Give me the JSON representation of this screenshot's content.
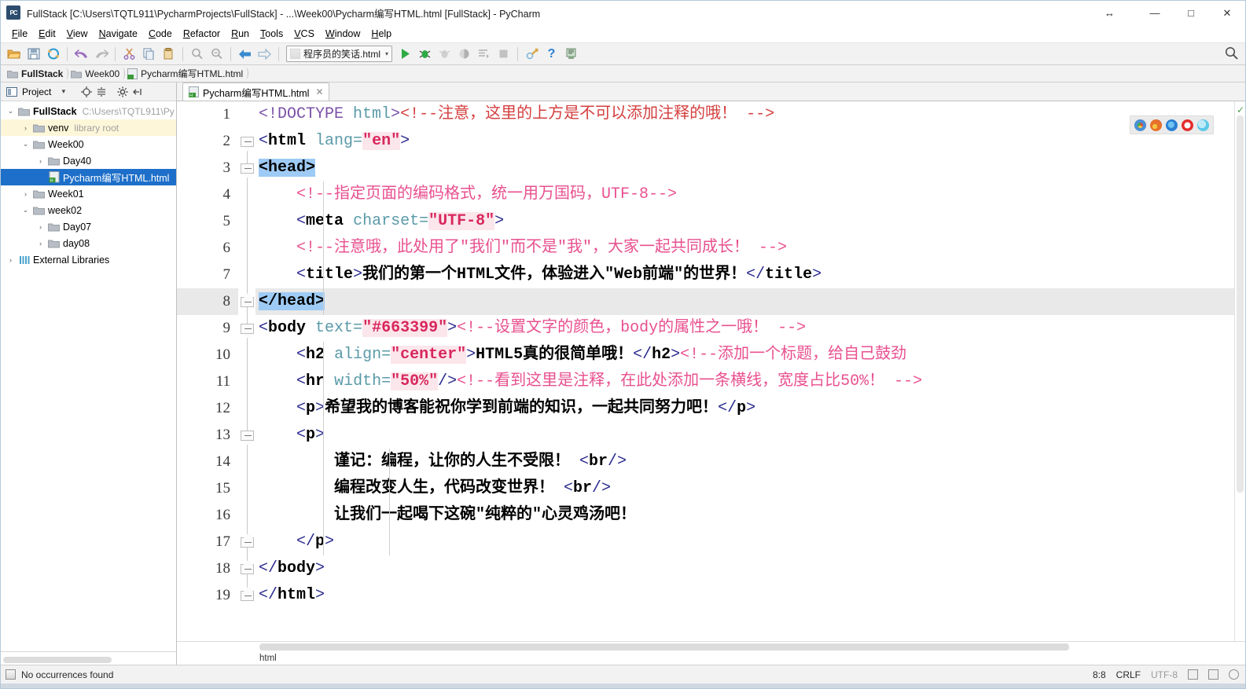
{
  "window": {
    "title": "FullStack [C:\\Users\\TQTL911\\PycharmProjects\\FullStack] - ...\\Week00\\Pycharm编写HTML.html [FullStack] - PyCharm",
    "app_icon_text": "PC",
    "resize_glyph": "↔",
    "minimize_glyph": "—",
    "maximize_glyph": "□",
    "close_glyph": "✕"
  },
  "menubar": {
    "items": [
      {
        "label": "File"
      },
      {
        "label": "Edit"
      },
      {
        "label": "View"
      },
      {
        "label": "Navigate"
      },
      {
        "label": "Code"
      },
      {
        "label": "Refactor"
      },
      {
        "label": "Run"
      },
      {
        "label": "Tools"
      },
      {
        "label": "VCS"
      },
      {
        "label": "Window"
      },
      {
        "label": "Help"
      }
    ]
  },
  "toolbar": {
    "run_config": {
      "label": "程序员的笑话.html",
      "arrow": "▾"
    },
    "search_glyph": "🔍",
    "help_glyph": "?",
    "icons": [
      "open-folder-icon",
      "save-all-icon",
      "sync-icon",
      "undo-icon",
      "redo-icon",
      "cut-icon",
      "copy-icon",
      "paste-icon",
      "find-icon",
      "replace-icon",
      "back-icon",
      "forward-icon",
      "run-icon",
      "debug-icon",
      "run-coverage-icon",
      "profile-icon",
      "run-with-console-icon",
      "stop-icon",
      "settings-icon",
      "help-icon",
      "update-icon"
    ]
  },
  "breadcrumb": {
    "items": [
      {
        "label": "FullStack",
        "icon": "folder-icon",
        "bold": true
      },
      {
        "label": "Week00",
        "icon": "folder-icon",
        "bold": false
      },
      {
        "label": "Pycharm编写HTML.html",
        "icon": "html-file-icon",
        "bold": false
      }
    ]
  },
  "project_panel": {
    "title": "Project",
    "dropdown_glyph": "▾",
    "toolbar_icons": [
      "locate-icon",
      "collapse-all-icon",
      "settings-icon",
      "hide-icon"
    ],
    "tree": [
      {
        "depth": 0,
        "arrow": "⌄",
        "icon": "folder-icon",
        "label": "FullStack",
        "bold": true,
        "sub": "C:\\Users\\TQTL911\\Py",
        "state": "normal"
      },
      {
        "depth": 1,
        "arrow": "›",
        "icon": "folder-icon",
        "label": "venv",
        "bold": false,
        "sub": "library root",
        "state": "highlight"
      },
      {
        "depth": 1,
        "arrow": "⌄",
        "icon": "folder-icon",
        "label": "Week00",
        "bold": false,
        "sub": "",
        "state": "normal"
      },
      {
        "depth": 2,
        "arrow": "›",
        "icon": "folder-icon",
        "label": "Day40",
        "bold": false,
        "sub": "",
        "state": "normal"
      },
      {
        "depth": 2,
        "arrow": "",
        "icon": "html-file-icon",
        "label": "Pycharm编写HTML.html",
        "bold": false,
        "sub": "",
        "state": "selected"
      },
      {
        "depth": 1,
        "arrow": "›",
        "icon": "folder-icon",
        "label": "Week01",
        "bold": false,
        "sub": "",
        "state": "normal"
      },
      {
        "depth": 1,
        "arrow": "⌄",
        "icon": "folder-icon",
        "label": "week02",
        "bold": false,
        "sub": "",
        "state": "normal"
      },
      {
        "depth": 2,
        "arrow": "›",
        "icon": "folder-icon",
        "label": "Day07",
        "bold": false,
        "sub": "",
        "state": "normal"
      },
      {
        "depth": 2,
        "arrow": "›",
        "icon": "folder-icon",
        "label": "day08",
        "bold": false,
        "sub": "",
        "state": "normal"
      },
      {
        "depth": 0,
        "arrow": "›",
        "icon": "external-libraries-icon",
        "label": "External Libraries",
        "bold": false,
        "sub": "",
        "state": "normal"
      }
    ]
  },
  "editor": {
    "tab": {
      "label": "Pycharm编写HTML.html",
      "icon": "html-file-icon",
      "close_glyph": "✕"
    },
    "current_line": 8,
    "line_count": 19,
    "browser_preview": {
      "icons": [
        "chrome-icon",
        "firefox-icon",
        "edge-icon",
        "opera-icon",
        "safari-icon"
      ],
      "colors": [
        "#d94a3d",
        "#e8712a",
        "#2a7fd4",
        "#e32b2b",
        "#5cc8e8"
      ]
    },
    "bottom_breadcrumb": "html",
    "lines": [
      {
        "n": 1,
        "fold": "none"
      },
      {
        "n": 2,
        "fold": "start"
      },
      {
        "n": 3,
        "fold": "start"
      },
      {
        "n": 4,
        "fold": "none"
      },
      {
        "n": 5,
        "fold": "none"
      },
      {
        "n": 6,
        "fold": "none"
      },
      {
        "n": 7,
        "fold": "none"
      },
      {
        "n": 8,
        "fold": "end"
      },
      {
        "n": 9,
        "fold": "start"
      },
      {
        "n": 10,
        "fold": "none"
      },
      {
        "n": 11,
        "fold": "none"
      },
      {
        "n": 12,
        "fold": "none"
      },
      {
        "n": 13,
        "fold": "start"
      },
      {
        "n": 14,
        "fold": "none"
      },
      {
        "n": 15,
        "fold": "none"
      },
      {
        "n": 16,
        "fold": "none"
      },
      {
        "n": 17,
        "fold": "end"
      },
      {
        "n": 18,
        "fold": "end"
      },
      {
        "n": 19,
        "fold": "end"
      }
    ],
    "code": [
      {
        "line": 1,
        "tokens": [
          {
            "t": "<!DOCTYPE ",
            "c": "s-doct"
          },
          {
            "t": "html",
            "c": "s-attr"
          },
          {
            "t": ">",
            "c": "s-doct"
          },
          {
            "t": "<!--注意，这里的上方是不可以添加注释的哦！ -->",
            "c": "s-cmtd"
          }
        ]
      },
      {
        "line": 2,
        "tokens": [
          {
            "t": "<",
            "c": "s-brk"
          },
          {
            "t": "html",
            "c": "s-tag"
          },
          {
            "t": " ",
            "c": "s-plain"
          },
          {
            "t": "lang=",
            "c": "s-attr"
          },
          {
            "t": "\"en\"",
            "c": "s-val"
          },
          {
            "t": ">",
            "c": "s-brk"
          }
        ]
      },
      {
        "line": 3,
        "tokens": [
          {
            "t": "<head>",
            "c": "s-tag s-sel"
          }
        ]
      },
      {
        "line": 4,
        "tokens": [
          {
            "t": "    ",
            "c": "s-plain"
          },
          {
            "t": "<!--指定页面的编码格式，统一用万国码，UTF-8-->",
            "c": "s-cmt"
          }
        ]
      },
      {
        "line": 5,
        "tokens": [
          {
            "t": "    ",
            "c": "s-plain"
          },
          {
            "t": "<",
            "c": "s-brk"
          },
          {
            "t": "meta",
            "c": "s-tag"
          },
          {
            "t": " ",
            "c": "s-plain"
          },
          {
            "t": "charset=",
            "c": "s-attr"
          },
          {
            "t": "\"UTF-8\"",
            "c": "s-val"
          },
          {
            "t": ">",
            "c": "s-brk"
          }
        ]
      },
      {
        "line": 6,
        "tokens": [
          {
            "t": "    ",
            "c": "s-plain"
          },
          {
            "t": "<!--注意哦，此处用了\"我们\"而不是\"我\"，大家一起共同成长！ -->",
            "c": "s-cmt"
          }
        ]
      },
      {
        "line": 7,
        "tokens": [
          {
            "t": "    ",
            "c": "s-plain"
          },
          {
            "t": "<",
            "c": "s-brk"
          },
          {
            "t": "title",
            "c": "s-tag"
          },
          {
            "t": ">",
            "c": "s-brk"
          },
          {
            "t": "我们的第一个HTML文件，体验进入\"Web前端\"的世界！",
            "c": "s-txt"
          },
          {
            "t": "</",
            "c": "s-brk"
          },
          {
            "t": "title",
            "c": "s-tag"
          },
          {
            "t": ">",
            "c": "s-brk"
          }
        ]
      },
      {
        "line": 8,
        "tokens": [
          {
            "t": "</head>",
            "c": "s-tag s-sel"
          }
        ]
      },
      {
        "line": 9,
        "tokens": [
          {
            "t": "<",
            "c": "s-brk"
          },
          {
            "t": "body",
            "c": "s-tag"
          },
          {
            "t": " ",
            "c": "s-plain"
          },
          {
            "t": "text=",
            "c": "s-attr"
          },
          {
            "t": "\"#663399\"",
            "c": "s-val"
          },
          {
            "t": ">",
            "c": "s-brk"
          },
          {
            "t": "<!--设置文字的颜色，body的属性之一哦！ -->",
            "c": "s-cmt"
          }
        ]
      },
      {
        "line": 10,
        "tokens": [
          {
            "t": "    ",
            "c": "s-plain"
          },
          {
            "t": "<",
            "c": "s-brk"
          },
          {
            "t": "h2",
            "c": "s-tag"
          },
          {
            "t": " ",
            "c": "s-plain"
          },
          {
            "t": "align=",
            "c": "s-attr"
          },
          {
            "t": "\"center\"",
            "c": "s-val"
          },
          {
            "t": ">",
            "c": "s-brk"
          },
          {
            "t": "HTML5真的很简单哦！",
            "c": "s-txt"
          },
          {
            "t": "</",
            "c": "s-brk"
          },
          {
            "t": "h2",
            "c": "s-tag"
          },
          {
            "t": ">",
            "c": "s-brk"
          },
          {
            "t": "<!--添加一个标题，给自己鼓劲",
            "c": "s-cmt"
          }
        ]
      },
      {
        "line": 11,
        "tokens": [
          {
            "t": "    ",
            "c": "s-plain"
          },
          {
            "t": "<",
            "c": "s-brk"
          },
          {
            "t": "hr",
            "c": "s-tag"
          },
          {
            "t": " ",
            "c": "s-plain"
          },
          {
            "t": "width=",
            "c": "s-attr"
          },
          {
            "t": "\"50%\"",
            "c": "s-val"
          },
          {
            "t": "/>",
            "c": "s-brk"
          },
          {
            "t": "<!--看到这里是注释，在此处添加一条横线，宽度占比50%！ -->",
            "c": "s-cmt"
          }
        ]
      },
      {
        "line": 12,
        "tokens": [
          {
            "t": "    ",
            "c": "s-plain"
          },
          {
            "t": "<",
            "c": "s-brk"
          },
          {
            "t": "p",
            "c": "s-tag"
          },
          {
            "t": ">",
            "c": "s-brk"
          },
          {
            "t": "希望我的博客能祝你学到前端的知识，一起共同努力吧！",
            "c": "s-txt"
          },
          {
            "t": "</",
            "c": "s-brk"
          },
          {
            "t": "p",
            "c": "s-tag"
          },
          {
            "t": ">",
            "c": "s-brk"
          }
        ]
      },
      {
        "line": 13,
        "tokens": [
          {
            "t": "    ",
            "c": "s-plain"
          },
          {
            "t": "<",
            "c": "s-brk"
          },
          {
            "t": "p",
            "c": "s-tag"
          },
          {
            "t": ">",
            "c": "s-brk"
          }
        ]
      },
      {
        "line": 14,
        "tokens": [
          {
            "t": "        ",
            "c": "s-plain"
          },
          {
            "t": "谨记：编程，让你的人生不受限！",
            "c": "s-txt"
          },
          {
            "t": " <",
            "c": "s-brk"
          },
          {
            "t": "br",
            "c": "s-tag"
          },
          {
            "t": "/>",
            "c": "s-brk"
          }
        ]
      },
      {
        "line": 15,
        "tokens": [
          {
            "t": "        ",
            "c": "s-plain"
          },
          {
            "t": "编程改变人生，代码改变世界！",
            "c": "s-txt"
          },
          {
            "t": " <",
            "c": "s-brk"
          },
          {
            "t": "br",
            "c": "s-tag"
          },
          {
            "t": "/>",
            "c": "s-brk"
          }
        ]
      },
      {
        "line": 16,
        "tokens": [
          {
            "t": "        ",
            "c": "s-plain"
          },
          {
            "t": "让我们一起喝下这碗\"纯粹的\"心灵鸡汤吧！",
            "c": "s-txt"
          }
        ]
      },
      {
        "line": 17,
        "tokens": [
          {
            "t": "    ",
            "c": "s-plain"
          },
          {
            "t": "</",
            "c": "s-brk"
          },
          {
            "t": "p",
            "c": "s-tag"
          },
          {
            "t": ">",
            "c": "s-brk"
          }
        ]
      },
      {
        "line": 18,
        "tokens": [
          {
            "t": "</",
            "c": "s-brk"
          },
          {
            "t": "body",
            "c": "s-tag"
          },
          {
            "t": ">",
            "c": "s-brk"
          }
        ]
      },
      {
        "line": 19,
        "tokens": [
          {
            "t": "</",
            "c": "s-brk"
          },
          {
            "t": "html",
            "c": "s-tag"
          },
          {
            "t": ">",
            "c": "s-brk"
          }
        ]
      }
    ]
  },
  "statusbar": {
    "message": "No occurrences found",
    "caret_position": "8:8",
    "line_separator": "CRLF",
    "encoding": "UTF-8",
    "lock_glyph": "🔒",
    "inspection_glyph": "☻"
  },
  "colors": {
    "selection_blue": "#9ecbf5",
    "tree_selection": "#1d6fc9",
    "comment_pink": "#e8508f",
    "comment_red": "#d43f3f",
    "attr_value": "#d8275c",
    "attr_name": "#5a9aa8",
    "doctype_purple": "#7a50a8",
    "bracket_blue": "#2a2a8f"
  }
}
